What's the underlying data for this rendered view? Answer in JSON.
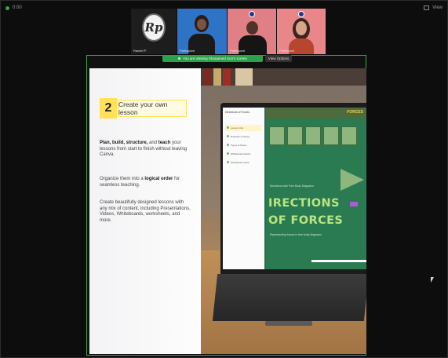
{
  "topbar": {
    "left_text": "0:00",
    "right_text": "View"
  },
  "participants": [
    {
      "name": "Rachel P.",
      "logo_text": "Rp"
    },
    {
      "name": "Participant"
    },
    {
      "name": "Participant"
    },
    {
      "name": "Participant"
    }
  ],
  "share": {
    "banner_text": "You are viewing Sharpened Sun's screen",
    "view_options": "View Options"
  },
  "slide": {
    "number": "2",
    "title": "Create your own lesson",
    "paragraph1_strong1": "Plan, build, structure,",
    "paragraph1_mid": " and ",
    "paragraph1_strong2": "teach",
    "paragraph1_rest": " your lessons from start to finish without leaving Canva.",
    "paragraph2_start": "Organize them into a ",
    "paragraph2_strong": "logical order",
    "paragraph2_end": " for seamless teaching.",
    "paragraph3": "Create beautifully designed lessons with any mix of content, including Presentations, Videos, Whiteboards, worksheets, and more."
  },
  "laptop": {
    "sidebar_title": "Directions of Forces",
    "sidebar_items": [
      "Lesson intro",
      "Direction of forces",
      "Types of forces",
      "Whiteboard activity",
      "Worksheet review"
    ],
    "big_line1": "IRECTIONS",
    "big_line2": "OF FORCES",
    "sub_line": "Directions with Free Body Diagrams",
    "bottom_line": "Representing forces in free body diagrams",
    "top_tag": "FORCES",
    "progress": 0.62
  },
  "colors": {
    "accent": "#2da14a",
    "highlight": "#ffe25a",
    "canva_green": "#2b7b52"
  }
}
